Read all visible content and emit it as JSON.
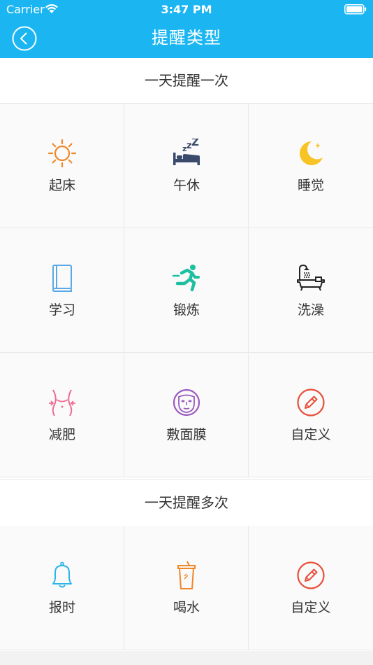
{
  "status": {
    "carrier": "Carrier",
    "time": "3:47 PM"
  },
  "nav": {
    "title": "提醒类型"
  },
  "sections": [
    {
      "title": "一天提醒一次",
      "items": [
        {
          "label": "起床",
          "icon": "sun-icon",
          "color": "#f0882a"
        },
        {
          "label": "午休",
          "icon": "bed-icon",
          "color": "#3a4a6b"
        },
        {
          "label": "睡觉",
          "icon": "moon-icon",
          "color": "#f7c325"
        },
        {
          "label": "学习",
          "icon": "book-icon",
          "color": "#5aa8e6"
        },
        {
          "label": "锻炼",
          "icon": "runner-icon",
          "color": "#1ebfa0"
        },
        {
          "label": "洗澡",
          "icon": "bathtub-icon",
          "color": "#222222"
        },
        {
          "label": "减肥",
          "icon": "waist-icon",
          "color": "#ee6c93"
        },
        {
          "label": "敷面膜",
          "icon": "face-mask-icon",
          "color": "#9b59c0"
        },
        {
          "label": "自定义",
          "icon": "pencil-icon",
          "color": "#e8503b"
        }
      ]
    },
    {
      "title": "一天提醒多次",
      "items": [
        {
          "label": "报时",
          "icon": "bell-icon",
          "color": "#2bb5e8"
        },
        {
          "label": "喝水",
          "icon": "cup-icon",
          "color": "#f0882a"
        },
        {
          "label": "自定义",
          "icon": "pencil-icon",
          "color": "#e8503b"
        }
      ]
    }
  ]
}
